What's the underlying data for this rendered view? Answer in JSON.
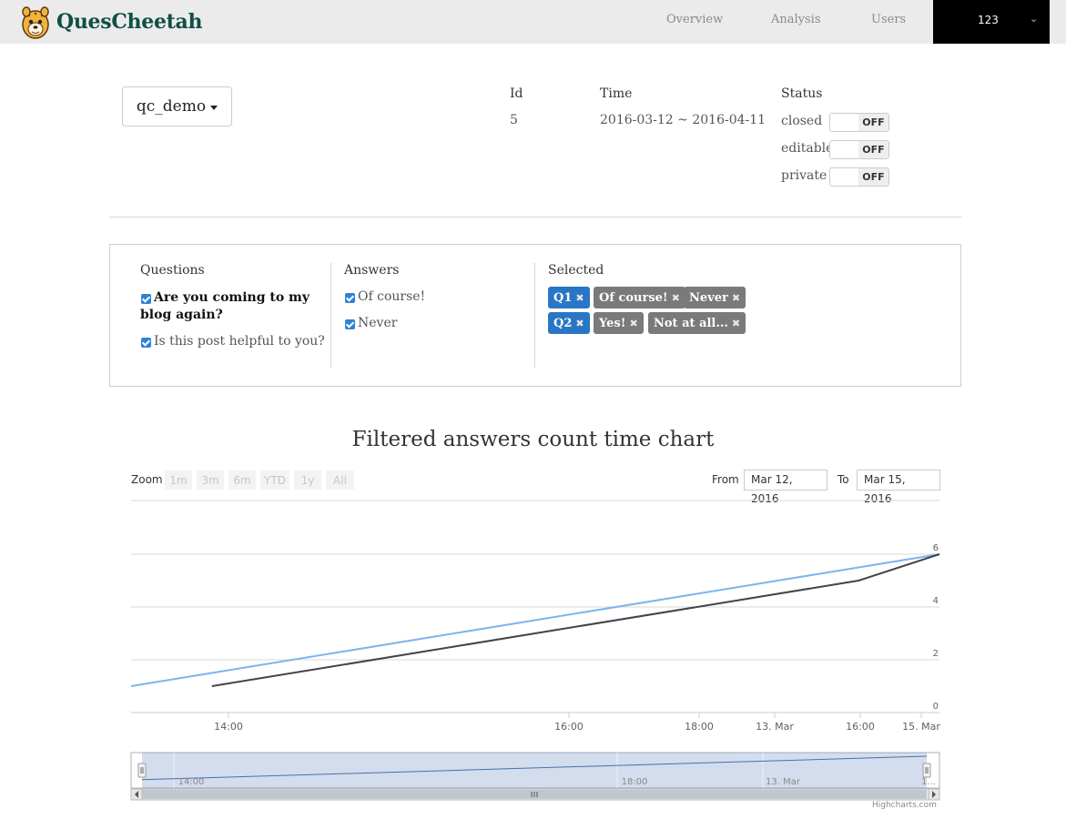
{
  "navbar": {
    "brand": "QuesCheetah",
    "links": [
      "Overview",
      "Analysis",
      "Users"
    ],
    "user": "123"
  },
  "project": {
    "name": "qc_demo",
    "id_label": "Id",
    "id_value": "5",
    "time_label": "Time",
    "time_value": "2016-03-12 ~ 2016-04-11",
    "status_label": "Status",
    "statuses": [
      {
        "label": "closed",
        "state": "OFF"
      },
      {
        "label": "editable",
        "state": "OFF"
      },
      {
        "label": "private",
        "state": "OFF"
      }
    ]
  },
  "filters": {
    "questions_title": "Questions",
    "questions": [
      {
        "text": "Are you coming to my blog again?",
        "checked": true,
        "active": true
      },
      {
        "text": "Is this post helpful to you?",
        "checked": true,
        "active": false
      }
    ],
    "answers_title": "Answers",
    "answers": [
      {
        "text": "Of course!",
        "checked": true
      },
      {
        "text": "Never",
        "checked": true
      }
    ],
    "selected_title": "Selected",
    "selected": [
      {
        "question": "Q1",
        "answers": [
          "Of course!",
          "Never"
        ]
      },
      {
        "question": "Q2",
        "answers": [
          "Yes!",
          "Not at all..."
        ]
      }
    ]
  },
  "chart": {
    "title": "Filtered answers count time chart",
    "zoom_label": "Zoom",
    "zoom_buttons": [
      "1m",
      "3m",
      "6m",
      "YTD",
      "1y",
      "All"
    ],
    "from_label": "From",
    "from_value": "Mar 12, 2016",
    "to_label": "To",
    "to_value": "Mar 15, 2016",
    "navigator_labels": [
      "14:00",
      "18:00",
      "13. Mar",
      "1..."
    ],
    "credits": "Highcharts.com",
    "colors": {
      "series1": "#7cb5ec",
      "series2": "#434348",
      "navigator": "#4572a7"
    }
  },
  "chart_data": {
    "type": "line",
    "title": "Filtered answers count time chart",
    "xlabel": "",
    "ylabel": "",
    "x_ticks": [
      "14:00",
      "16:00",
      "18:00",
      "13. Mar",
      "16:00",
      "15. Mar"
    ],
    "y_ticks": [
      0,
      2,
      4,
      6
    ],
    "ylim": [
      0,
      6
    ],
    "grid": true,
    "series": [
      {
        "points": [
          [
            0.0,
            1.0
          ],
          [
            1.0,
            6.0
          ]
        ]
      },
      {
        "points": [
          [
            0.1,
            1.0
          ],
          [
            0.9,
            5.0
          ],
          [
            1.0,
            6.0
          ]
        ]
      }
    ]
  }
}
